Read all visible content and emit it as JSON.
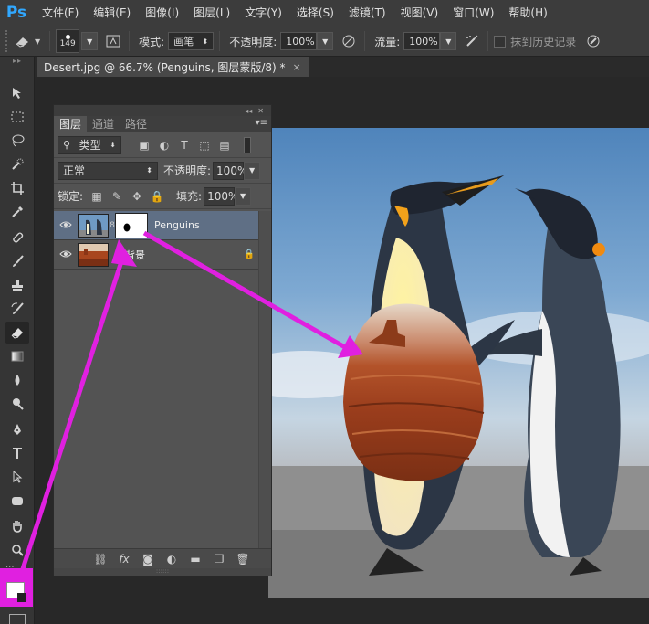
{
  "app": {
    "logo": "Ps"
  },
  "menu": [
    "文件(F)",
    "编辑(E)",
    "图像(I)",
    "图层(L)",
    "文字(Y)",
    "选择(S)",
    "滤镜(T)",
    "视图(V)",
    "窗口(W)",
    "帮助(H)"
  ],
  "options": {
    "brush_size": "149",
    "mode_label": "模式:",
    "mode_value": "画笔",
    "opacity_label": "不透明度:",
    "opacity_value": "100%",
    "flow_label": "流量:",
    "flow_value": "100%",
    "erase_history_label": "抹到历史记录"
  },
  "document": {
    "tab_title": "Desert.jpg @ 66.7% (Penguins, 图层蒙版/8) *",
    "close": "×"
  },
  "layers_panel": {
    "tabs": [
      "图层",
      "通道",
      "路径"
    ],
    "filter_label": "类型",
    "blend_mode": "正常",
    "opacity_label": "不透明度:",
    "opacity_value": "100%",
    "lock_label": "锁定:",
    "fill_label": "填充:",
    "fill_value": "100%",
    "layers": [
      {
        "name": "Penguins",
        "selected": true,
        "has_mask": true
      },
      {
        "name": "背景",
        "selected": false,
        "locked": true
      }
    ]
  },
  "icons": {
    "eye": "eye-icon",
    "lock": "lock-icon",
    "link": "link-icon",
    "fx": "fx"
  },
  "colors": {
    "accent_arrow": "#e020e0",
    "selected_layer": "#5f6f85",
    "ps_blue": "#31a8ff"
  }
}
